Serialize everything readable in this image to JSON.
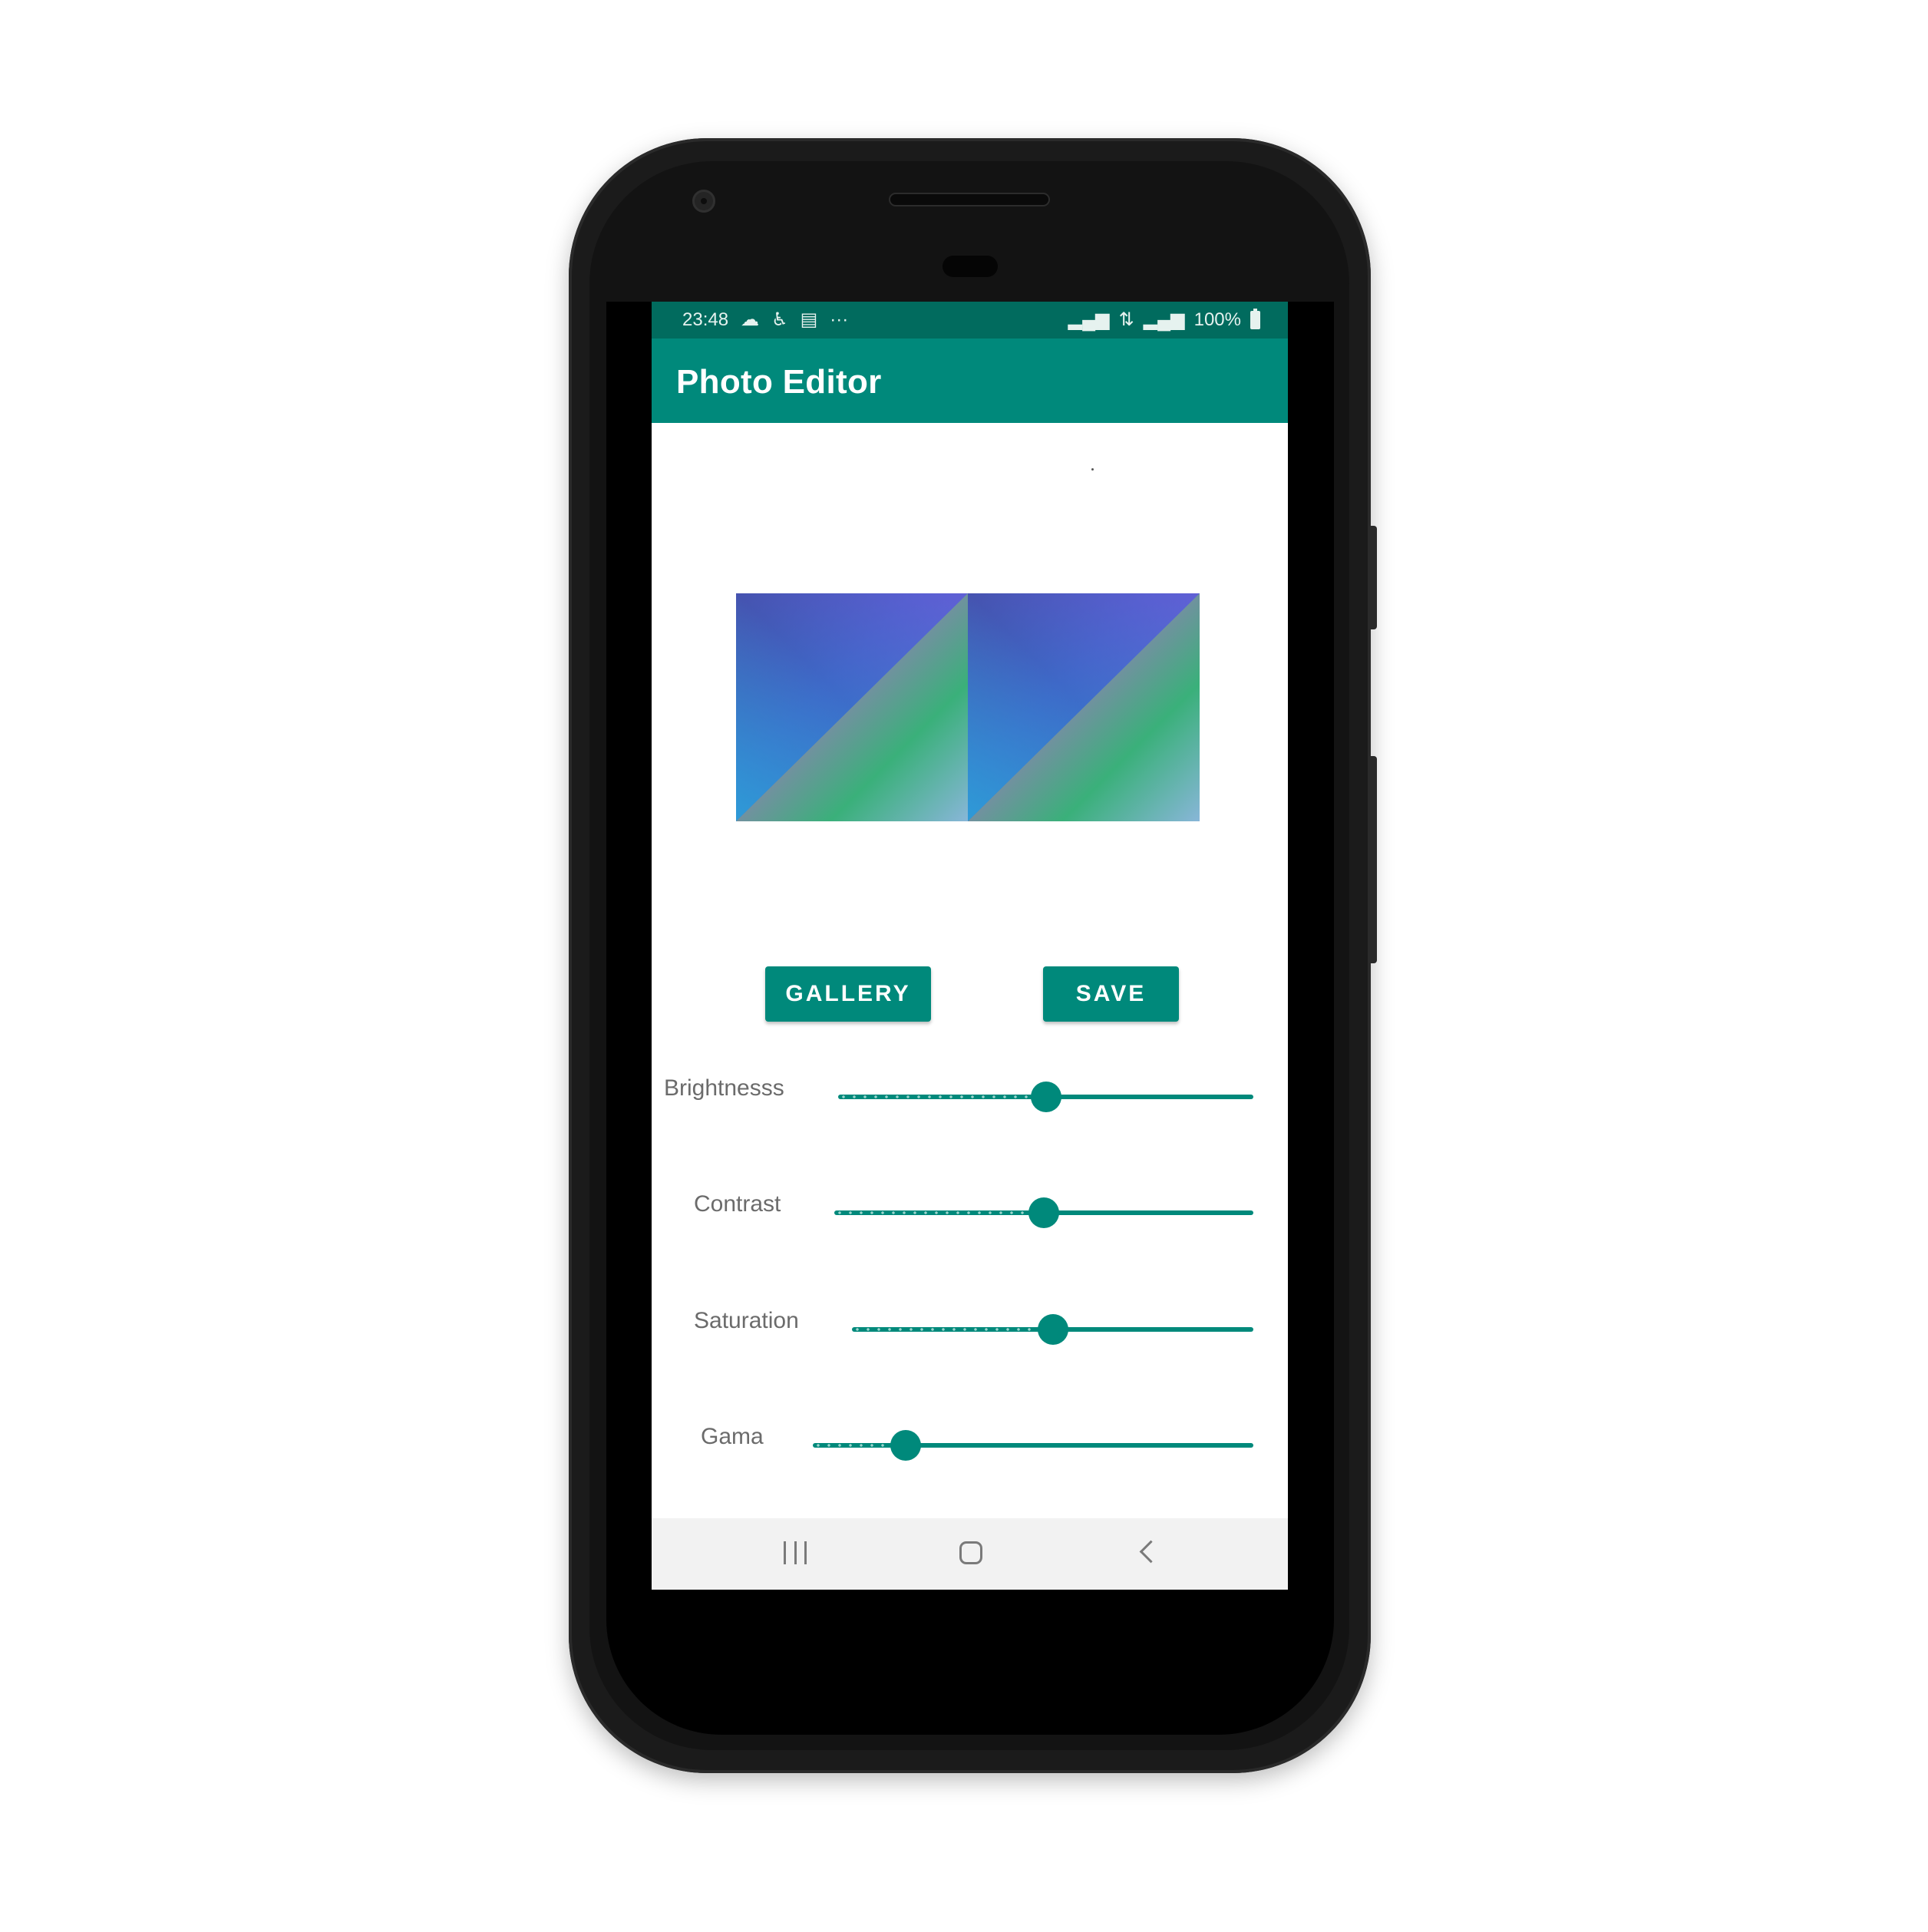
{
  "status_bar": {
    "time": "23:48",
    "left_icons": [
      "cloud-icon",
      "accessibility-icon",
      "calendar-icon",
      "more-icon"
    ],
    "right_icons": [
      "signal-icon",
      "data-4g-icon",
      "signal-icon-2"
    ],
    "battery_text": "100%",
    "ellipsis": "···",
    "color": "#016b5e"
  },
  "app_bar": {
    "title": "Photo Editor",
    "color": "#00897b"
  },
  "actions": {
    "gallery_label": "GALLERY",
    "save_label": "SAVE"
  },
  "adjustments": [
    {
      "label": "Brightnesss",
      "value": 0.5
    },
    {
      "label": "Contrast",
      "value": 0.5
    },
    {
      "label": "Saturation",
      "value": 0.5
    },
    {
      "label": "Gama",
      "value": 0.21
    }
  ],
  "nav_bar": {
    "icons": [
      "recents-icon",
      "home-icon",
      "back-icon"
    ]
  }
}
